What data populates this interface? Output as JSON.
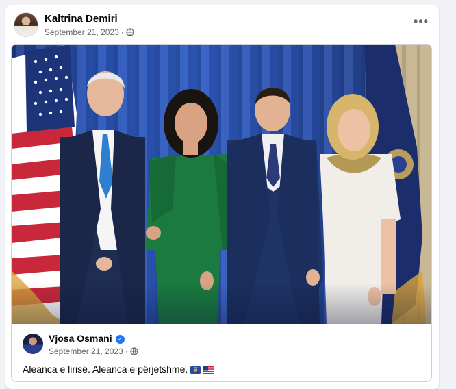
{
  "post": {
    "author": "Kaltrina Demiri",
    "date": "September 21, 2023",
    "separator": "·",
    "more_label": "•••"
  },
  "shared": {
    "author": "Vjosa Osmani",
    "verified_mark": "✓",
    "date": "September 21, 2023",
    "separator": "·",
    "caption": "Aleanca e lirisë. Aleanca e përjetshme."
  },
  "colors": {
    "page_bg": "#f0f2f5",
    "card_bg": "#ffffff",
    "text_primary": "#050505",
    "text_secondary": "#65676b",
    "verified_blue": "#1877f2",
    "curtain_blue": "#2a55b8"
  },
  "icons": [
    "globe-icon",
    "more-options-icon",
    "verified-badge-icon",
    "kosovo-flag-icon",
    "us-flag-icon"
  ]
}
